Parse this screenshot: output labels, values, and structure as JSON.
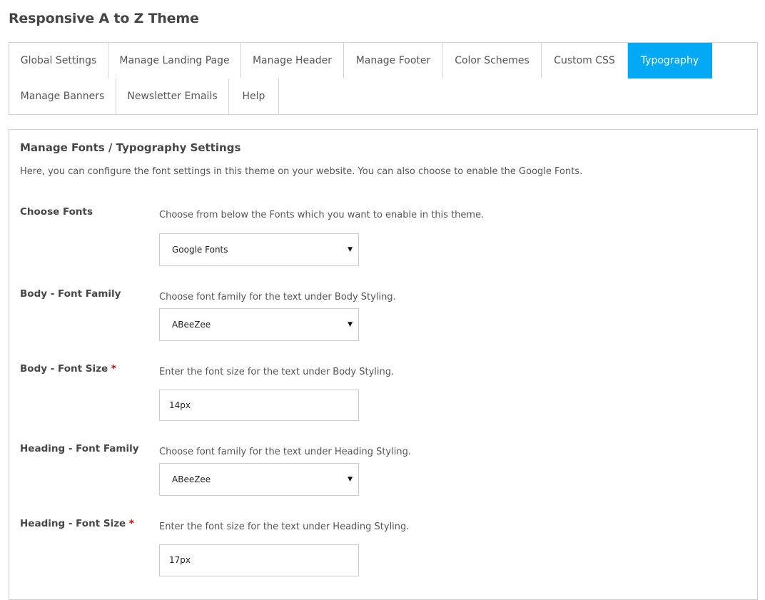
{
  "header": {
    "title": "Responsive A to Z Theme"
  },
  "tabs": {
    "row1": [
      {
        "label": "Global Settings"
      },
      {
        "label": "Manage Landing Page"
      },
      {
        "label": "Manage Header"
      },
      {
        "label": "Manage Footer"
      },
      {
        "label": "Color Schemes"
      },
      {
        "label": "Custom CSS"
      },
      {
        "label": "Typography",
        "active": true
      }
    ],
    "row2": [
      {
        "label": "Manage Banners"
      },
      {
        "label": "Newsletter Emails"
      },
      {
        "label": "Help"
      }
    ],
    "active_color": "#03A9F4"
  },
  "panel": {
    "title": "Manage Fonts / Typography Settings",
    "description": "Here, you can configure the font settings in this theme on your website. You can also choose to enable the Google Fonts.",
    "fields": [
      {
        "label": "Choose Fonts",
        "required": false,
        "help": "Choose from below the Fonts which you want to enable in this theme.",
        "type": "select",
        "value": "Google Fonts"
      },
      {
        "label": "Body - Font Family",
        "required": false,
        "help": "Choose font family for the text under Body Styling.",
        "type": "select",
        "value": "ABeeZee"
      },
      {
        "label": "Body - Font Size",
        "required": true,
        "help": "Enter the font size for the text under Body Styling.",
        "type": "input",
        "value": "14px"
      },
      {
        "label": "Heading - Font Family",
        "required": false,
        "help": "Choose font family for the text under Heading Styling.",
        "type": "select",
        "value": "ABeeZee"
      },
      {
        "label": "Heading - Font Size",
        "required": true,
        "help": "Enter the font size for the text under Heading Styling.",
        "type": "input",
        "value": "17px"
      }
    ],
    "required_marker": "*",
    "select_caret": "▼"
  }
}
